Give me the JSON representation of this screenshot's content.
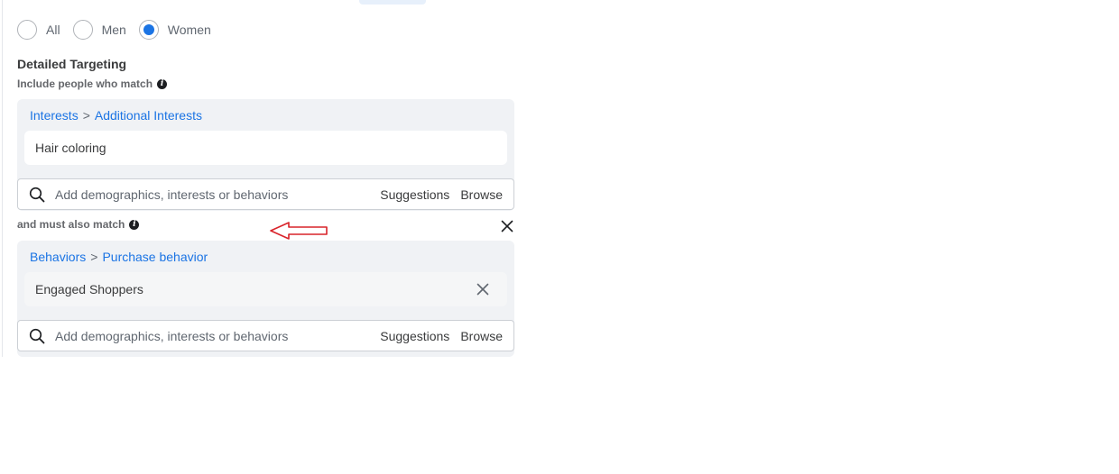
{
  "gender": {
    "options": [
      {
        "label": "All",
        "selected": false
      },
      {
        "label": "Men",
        "selected": false
      },
      {
        "label": "Women",
        "selected": true
      }
    ],
    "accent_color": "#1b74e4"
  },
  "detailed_targeting": {
    "title": "Detailed Targeting",
    "include_label": "Include people who match",
    "include_group": {
      "breadcrumb": {
        "category": "Interests",
        "separator": ">",
        "subcategory": "Additional Interests"
      },
      "items": [
        "Hair coloring"
      ]
    },
    "must_match_label": "and must also match",
    "must_group": {
      "breadcrumb": {
        "category": "Behaviors",
        "separator": ">",
        "subcategory": "Purchase behavior"
      },
      "items": [
        "Engaged Shoppers"
      ]
    },
    "search": {
      "placeholder": "Add demographics, interests or behaviors",
      "suggestions_label": "Suggestions",
      "browse_label": "Browse"
    }
  },
  "annotation": {
    "arrow_color": "#d9232a",
    "icon": "left-arrow-icon"
  }
}
